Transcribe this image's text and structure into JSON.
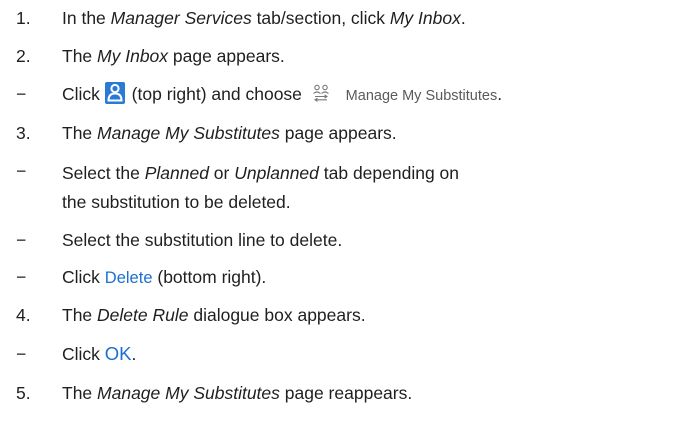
{
  "steps": [
    {
      "marker": "1.",
      "parts": [
        {
          "t": "In the "
        },
        {
          "t": "Manager Services",
          "i": true
        },
        {
          "t": " tab/section, click "
        },
        {
          "t": "My Inbox",
          "i": true
        },
        {
          "t": "."
        }
      ]
    },
    {
      "marker": "2.",
      "parts": [
        {
          "t": "The "
        },
        {
          "t": "My Inbox",
          "i": true
        },
        {
          "t": " page appears."
        }
      ]
    },
    {
      "marker": "−",
      "click": "Click",
      "middle": "(top right) and choose",
      "menu_label": "Manage My Substitutes",
      "end": "."
    },
    {
      "marker": "3.",
      "parts": [
        {
          "t": "The "
        },
        {
          "t": "Manage My Substitutes",
          "i": true
        },
        {
          "t": " page appears."
        }
      ]
    },
    {
      "marker": "−",
      "parts": [
        {
          "t": "Select the "
        },
        {
          "t": "Planned",
          "i": true
        },
        {
          "t": " or "
        },
        {
          "t": "Unplanned",
          "i": true
        },
        {
          "t": " tab depending on the substitution to be deleted."
        }
      ]
    },
    {
      "marker": "−",
      "parts": [
        {
          "t": "Select the substitution line to delete."
        }
      ]
    },
    {
      "marker": "−",
      "click": "Click",
      "button": "Delete",
      "end": "(bottom right)."
    },
    {
      "marker": "4.",
      "parts": [
        {
          "t": "The "
        },
        {
          "t": "Delete Rule",
          "i": true
        },
        {
          "t": " dialogue box appears."
        }
      ]
    },
    {
      "marker": "−",
      "click": "Click",
      "button": "OK",
      "end": "."
    },
    {
      "marker": "5.",
      "parts": [
        {
          "t": "The "
        },
        {
          "t": "Manage My Substitutes",
          "i": true
        },
        {
          "t": " page reappears."
        }
      ]
    }
  ],
  "icons": {
    "user": "user-icon",
    "substitutes": "manage-substitutes-icon"
  },
  "colors": {
    "link": "#1d6fd1",
    "icon_bg": "#2a7ad5",
    "menu_text": "#5a5a5a"
  }
}
